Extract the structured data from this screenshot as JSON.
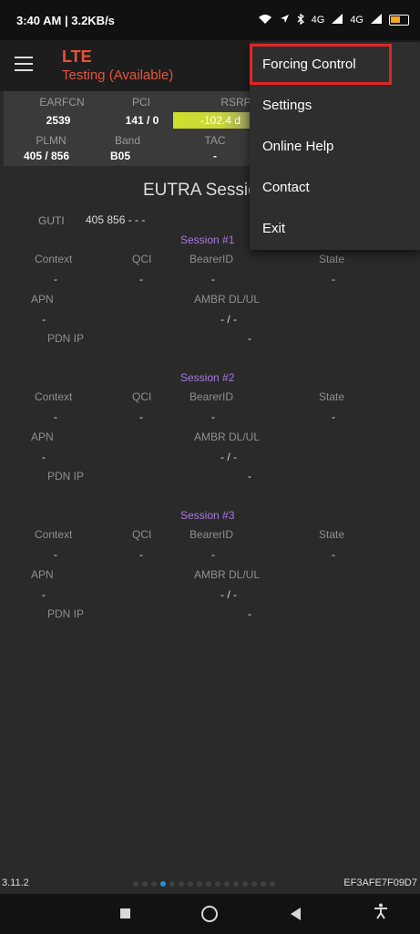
{
  "status_bar": {
    "time": "3:40 AM | 3.2KB/s",
    "icons": [
      "wifi-icon",
      "location-icon",
      "bluetooth-icon",
      "signal-icon",
      "battery-icon"
    ],
    "net_label_1": "4G",
    "net_label_2": "4G"
  },
  "app_bar": {
    "title": "LTE",
    "subtitle": "Testing (Available)",
    "menu_icon": "hamburger-menu-icon",
    "accent_color": "#e8533a"
  },
  "info_grid": {
    "earfcn_label": "EARFCN",
    "earfcn_value": "2539",
    "pci_label": "PCI",
    "pci_value": "141 / 0",
    "rsrp_label": "RSRP",
    "rsrp_value": "-102.4 d",
    "plmn_label": "PLMN",
    "plmn_value": "405 / 856",
    "band_label": "Band",
    "band_value": "B05",
    "tac_label": "TAC",
    "tac_value": "-"
  },
  "section": {
    "title": "EUTRA Sessio",
    "guti_label": "GUTI",
    "guti_value": "405  856  - - -"
  },
  "sessions": [
    {
      "title": "Session #1",
      "context_label": "Context",
      "context_value": "-",
      "qci_label": "QCI",
      "qci_value": "-",
      "bearer_label": "BearerID",
      "bearer_value": "-",
      "state_label": "State",
      "state_value": "-",
      "apn_label": "APN",
      "apn_value": "-",
      "ambr_label": "AMBR DL/UL",
      "ambr_value": "- / -",
      "pdn_label": "PDN IP",
      "pdn_value": "-"
    },
    {
      "title": "Session #2",
      "context_label": "Context",
      "context_value": "-",
      "qci_label": "QCI",
      "qci_value": "-",
      "bearer_label": "BearerID",
      "bearer_value": "-",
      "state_label": "State",
      "state_value": "-",
      "apn_label": "APN",
      "apn_value": "-",
      "ambr_label": "AMBR DL/UL",
      "ambr_value": "- / -",
      "pdn_label": "PDN IP",
      "pdn_value": "-"
    },
    {
      "title": "Session #3",
      "context_label": "Context",
      "context_value": "-",
      "qci_label": "QCI",
      "qci_value": "-",
      "bearer_label": "BearerID",
      "bearer_value": "-",
      "state_label": "State",
      "state_value": "-",
      "apn_label": "APN",
      "apn_value": "-",
      "ambr_label": "AMBR DL/UL",
      "ambr_value": "- / -",
      "pdn_label": "PDN IP",
      "pdn_value": "-"
    }
  ],
  "menu": {
    "items": [
      "Forcing Control",
      "Settings",
      "Online Help",
      "Contact",
      "Exit"
    ],
    "highlight_color": "#e02626"
  },
  "footer": {
    "version": "3.11.2",
    "device_id": "EF3AFE7F09D7",
    "active_page_color": "#2c8fd6"
  },
  "nav_bar": {
    "icons": [
      "recents-square-icon",
      "home-circle-icon",
      "back-triangle-icon",
      "accessibility-icon"
    ]
  }
}
